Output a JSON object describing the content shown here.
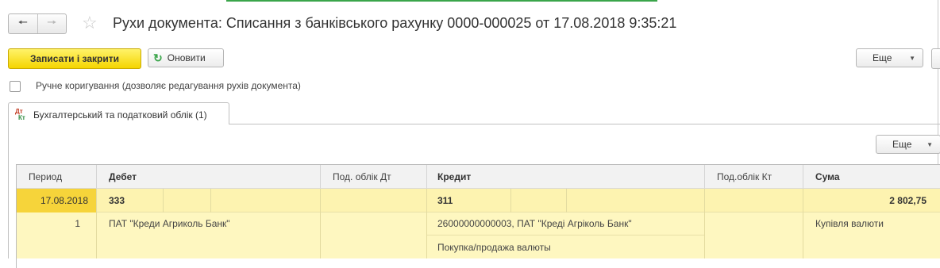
{
  "window": {
    "title": "Рухи документа: Списання з банківського рахунку 0000-000025 от 17.08.2018 9:35:21"
  },
  "nav": {
    "back_icon": "arrow-left-icon",
    "forward_icon": "arrow-right-icon",
    "favorite_icon": "star-icon"
  },
  "toolbar": {
    "save_close_label": "Записати і закрити",
    "refresh_label": "Оновити",
    "more_label": "Еще"
  },
  "manual_edit": {
    "label": "Ручне коригування (дозволяє редагування рухів документа)",
    "checked": false
  },
  "tabs": [
    {
      "label": "Бухгалтерський та податковий облік (1)",
      "icon_top": "Дт",
      "icon_bottom": "Кт",
      "active": true
    }
  ],
  "table_toolbar": {
    "more_label": "Еще"
  },
  "table": {
    "headers": {
      "period": "Период",
      "debit": "Дебет",
      "tax_dt": "Под. облік Дт",
      "credit": "Кредит",
      "tax_kt": "Под.облік Кт",
      "sum": "Сума"
    },
    "rows": [
      {
        "period": "17.08.2018",
        "number": "1",
        "debit_account": "333",
        "debit_subconto1": "ПАТ \"Креди Агриколь Банк\"",
        "credit_account": "311",
        "credit_subconto1": "26000000000003, ПАТ \"Креді Агріколь Банк\"",
        "credit_subconto2": "Покупка/продажа валюты",
        "sum": "2 802,75",
        "sum_note": "Купівля валюти"
      }
    ]
  },
  "colors": {
    "primary_button": "#f5d500",
    "row_highlight": "#fdf3b0",
    "selected_cell": "#f6d43a",
    "accent_green": "#3aa54a"
  }
}
